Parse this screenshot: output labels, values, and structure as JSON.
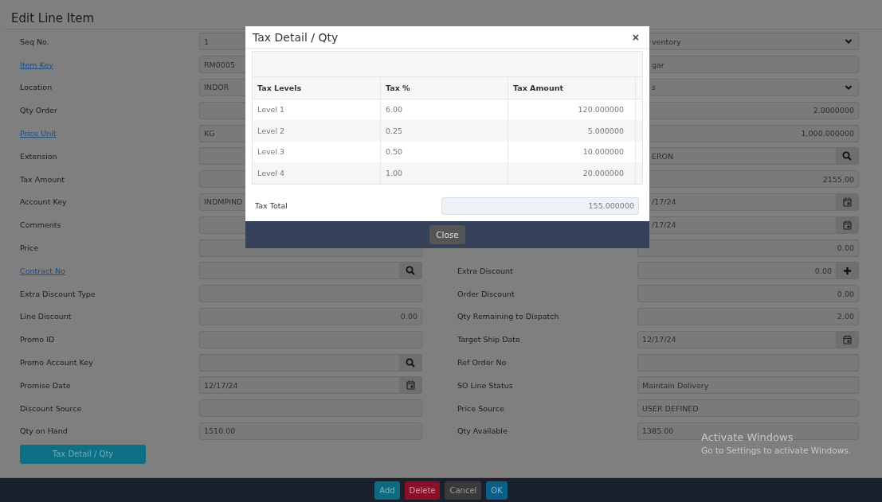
{
  "page": {
    "title": "Edit Line Item"
  },
  "form": {
    "left": [
      {
        "label": "Seq No.",
        "link": false,
        "kind": "text",
        "value": "1"
      },
      {
        "label": "Item Key",
        "link": true,
        "kind": "text",
        "value": "RM0005"
      },
      {
        "label": "Location",
        "link": false,
        "kind": "text",
        "value": "INDOR"
      },
      {
        "label": "Qty Order",
        "link": false,
        "kind": "text"
      },
      {
        "label": "Price Unit",
        "link": true,
        "kind": "text",
        "value": "KG"
      },
      {
        "label": "Extension",
        "link": false,
        "kind": "text"
      },
      {
        "label": "Tax Amount",
        "link": false,
        "kind": "text"
      },
      {
        "label": "Account Key",
        "link": false,
        "kind": "text",
        "value": "INDMPIND"
      },
      {
        "label": "Comments",
        "link": false,
        "kind": "text"
      },
      {
        "label": "Price",
        "link": false,
        "kind": "text"
      },
      {
        "label": "Contract No",
        "link": true,
        "kind": "search"
      },
      {
        "label": "Extra Discount Type",
        "link": false,
        "kind": "text"
      },
      {
        "label": "Line Discount",
        "link": false,
        "kind": "number",
        "value": "0.00"
      },
      {
        "label": "Promo ID",
        "link": false,
        "kind": "text"
      },
      {
        "label": "Promo Account Key",
        "link": false,
        "kind": "search"
      },
      {
        "label": "Promise Date",
        "link": false,
        "kind": "date",
        "value": "12/17/24"
      },
      {
        "label": "Discount Source",
        "link": false,
        "kind": "text"
      },
      {
        "label": "Qty on Hand",
        "link": false,
        "kind": "text",
        "value": "1510.00"
      }
    ],
    "right": [
      {
        "kind": "select",
        "value": "ventory"
      },
      {
        "kind": "text",
        "value": "gar"
      },
      {
        "kind": "select",
        "value": "s"
      },
      {
        "kind": "number",
        "value": "2.0000000"
      },
      {
        "kind": "number",
        "value": "1,000.000000"
      },
      {
        "kind": "search",
        "value": "ERON"
      },
      {
        "kind": "number",
        "value": "2155.00"
      },
      {
        "kind": "date",
        "value": "/17/24"
      },
      {
        "kind": "date",
        "value": "/17/24"
      },
      {
        "kind": "number",
        "value": "0.00"
      },
      {
        "label": "Extra Discount",
        "link": false,
        "kind": "plus",
        "value": "0.00"
      },
      {
        "label": "Order Discount",
        "link": false,
        "kind": "number",
        "value": "0.00"
      },
      {
        "label": "Qty Remaining to Dispatch",
        "link": false,
        "kind": "number",
        "value": "2.00"
      },
      {
        "label": "Target Ship Date",
        "link": false,
        "kind": "date",
        "value": "12/17/24"
      },
      {
        "label": "Ref Order No",
        "link": false,
        "kind": "text"
      },
      {
        "label": "SO Line Status",
        "link": false,
        "kind": "text",
        "value": "Maintain Delivery"
      },
      {
        "label": "Price Source",
        "link": false,
        "kind": "text",
        "value": "USER DEFINED"
      },
      {
        "label": "Qty Available",
        "link": false,
        "kind": "text",
        "value": "1385.00"
      }
    ],
    "tax_button": "Tax Detail / Qty"
  },
  "footer": {
    "buttons": [
      {
        "label": "Add",
        "kind": "add"
      },
      {
        "label": "Delete",
        "kind": "delete"
      },
      {
        "label": "Cancel",
        "kind": "cancel"
      },
      {
        "label": "OK",
        "kind": "ok"
      }
    ]
  },
  "activation": {
    "title": "Activate Windows",
    "hint": "Go to Settings to activate Windows."
  },
  "modal": {
    "title": "Tax Detail / Qty",
    "close_icon": "×",
    "columns": [
      "Tax Levels",
      "Tax %",
      "Tax Amount"
    ],
    "rows": [
      {
        "level": "Level 1",
        "percent": "6.00",
        "amount": "120.000000"
      },
      {
        "level": "Level 2",
        "percent": "0.25",
        "amount": "5.000000"
      },
      {
        "level": "Level 3",
        "percent": "0.50",
        "amount": "10.000000"
      },
      {
        "level": "Level 4",
        "percent": "1.00",
        "amount": "20.000000"
      }
    ],
    "total_label": "Tax Total",
    "total_value": "155.000000",
    "footer_button": "Close"
  }
}
